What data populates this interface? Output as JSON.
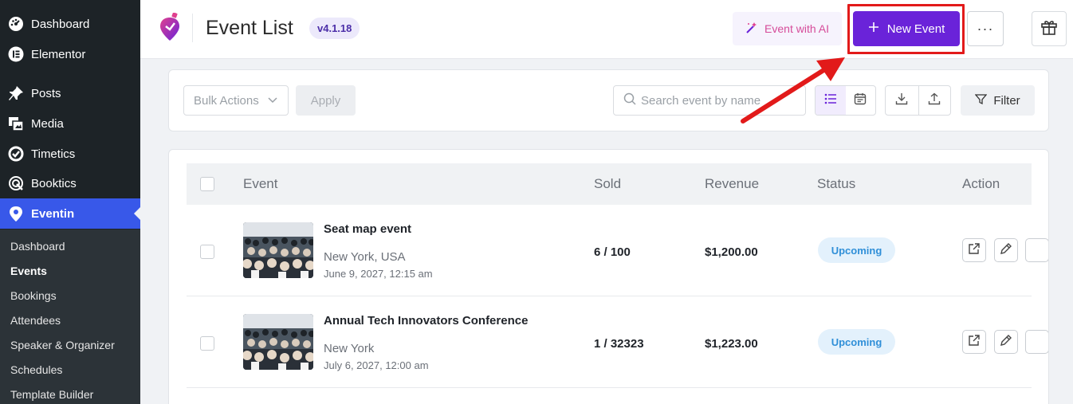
{
  "sidebar": {
    "menu": [
      {
        "label": "Dashboard",
        "icon": "dashboard-icon"
      },
      {
        "label": "Elementor",
        "icon": "elementor-icon"
      },
      {
        "label": "Posts",
        "icon": "pin-icon"
      },
      {
        "label": "Media",
        "icon": "media-icon"
      },
      {
        "label": "Timetics",
        "icon": "timetics-icon"
      },
      {
        "label": "Booktics",
        "icon": "booktics-icon"
      },
      {
        "label": "Eventin",
        "icon": "eventin-icon"
      }
    ],
    "submenu": [
      {
        "label": "Dashboard"
      },
      {
        "label": "Events"
      },
      {
        "label": "Bookings"
      },
      {
        "label": "Attendees"
      },
      {
        "label": "Speaker & Organizer"
      },
      {
        "label": "Schedules"
      },
      {
        "label": "Template Builder"
      }
    ],
    "active_menu": "Eventin",
    "current_submenu": "Events",
    "colors": {
      "bg": "#1d2327",
      "active": "#3858e9"
    }
  },
  "header": {
    "title": "Event List",
    "version": "v4.1.18",
    "ai_button": "Event with AI",
    "new_event_button": "New Event",
    "more_button": "···",
    "accent": "#6a23d9"
  },
  "toolbar": {
    "bulk_actions": "Bulk Actions",
    "apply": "Apply",
    "search_placeholder": "Search event by name",
    "filter": "Filter"
  },
  "table": {
    "columns": {
      "event": "Event",
      "sold": "Sold",
      "revenue": "Revenue",
      "status": "Status",
      "action": "Action"
    },
    "rows": [
      {
        "name": "Seat map event",
        "location": "New York, USA",
        "date": "June 9, 2027, 12:15 am",
        "sold": "6 / 100",
        "revenue": "$1,200.00",
        "status": "Upcoming"
      },
      {
        "name": "Annual Tech Innovators Conference",
        "location": "New York",
        "date": "July 6, 2027, 12:00 am",
        "sold": "1 / 32323",
        "revenue": "$1,223.00",
        "status": "Upcoming"
      }
    ]
  }
}
